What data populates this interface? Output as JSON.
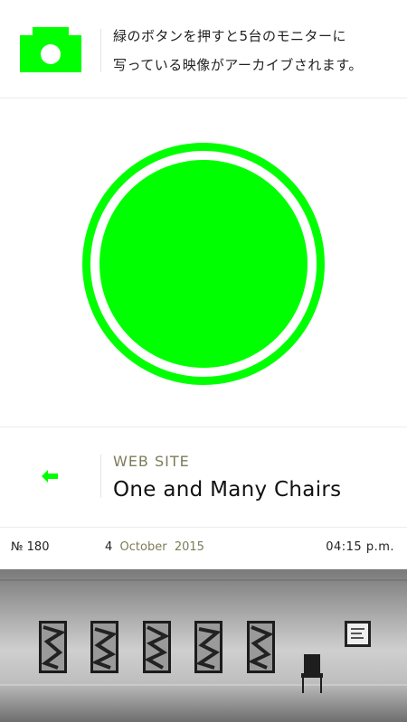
{
  "header": {
    "icon": "camera-icon",
    "accent": "#00ff00",
    "line1": "緑のボタンを押すと5台のモニターに",
    "line2": "写っている映像がアーカイブされます。"
  },
  "record_button": {
    "icon": "record-button",
    "color": "#00ff00"
  },
  "nav": {
    "back_icon": "back-arrow-icon",
    "label": "WEB SITE",
    "title": "One and Many Chairs"
  },
  "info": {
    "number": "№ 180",
    "day": "4",
    "month": "October",
    "year": "2015",
    "time": "04:15 p.m."
  },
  "photo": {
    "subject": "gallery-installation-photo",
    "frame_count": 5
  }
}
